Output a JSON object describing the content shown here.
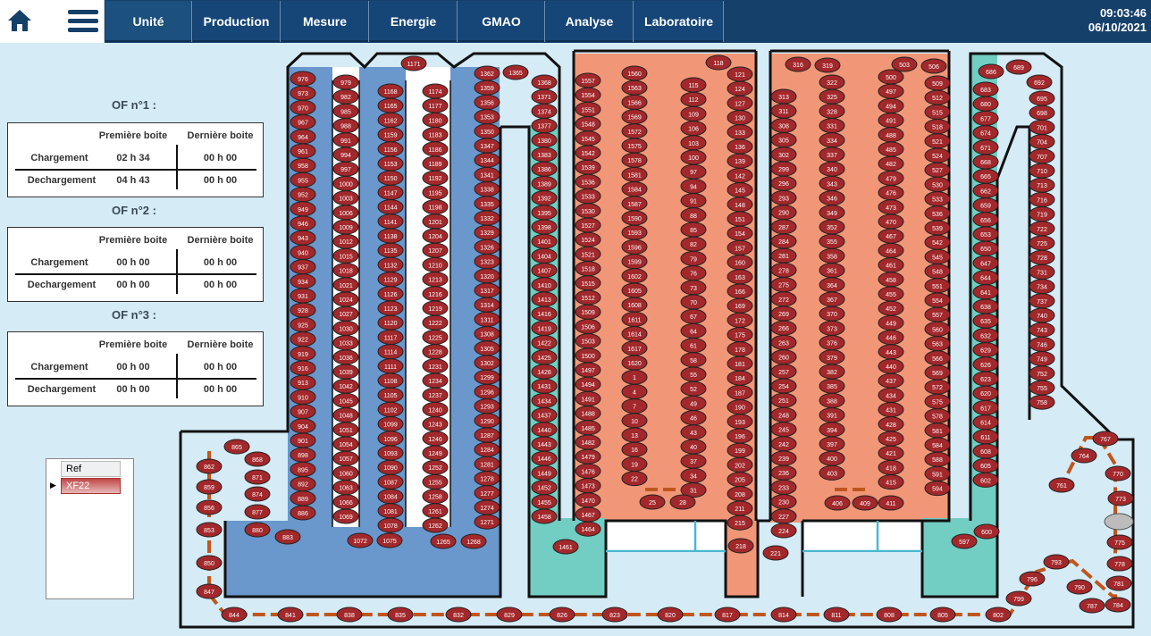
{
  "header": {
    "nav": [
      "Unité",
      "Production",
      "Mesure",
      "Energie",
      "GMAO",
      "Analyse",
      "Laboratoire"
    ],
    "time": "09:03:46",
    "date": "06/10/2021"
  },
  "of_panels": [
    {
      "title": "OF n°1 :",
      "col1": "Première boite",
      "col2": "Dernière boite",
      "row1": "Chargement",
      "row2": "Dechargement",
      "v11": "02 h 34",
      "v12": "00 h 00",
      "v21": "04 h 43",
      "v22": "00 h 00"
    },
    {
      "title": "OF n°2 :",
      "col1": "Première boite",
      "col2": "Dernière boite",
      "row1": "Chargement",
      "row2": "Dechargement",
      "v11": "00 h 00",
      "v12": "00 h 00",
      "v21": "00 h 00",
      "v22": "00 h 00"
    },
    {
      "title": "OF n°3 :",
      "col1": "Première boite",
      "col2": "Dernière boite",
      "row1": "Chargement",
      "row2": "Dechargement",
      "v11": "00 h 00",
      "v12": "00 h 00",
      "v21": "00 h 00",
      "v22": "00 h 00"
    }
  ],
  "ref_table": {
    "header": "Ref",
    "value": "XF22"
  },
  "plant": {
    "colors": {
      "box": "#a3282b",
      "zone_blue": "#6a97cc",
      "zone_salmon": "#f19778",
      "zone_teal": "#72cdc2",
      "path": "#c0561c"
    },
    "columns": [
      {
        "labels": [
          "976",
          "973",
          "970",
          "967",
          "964",
          "961",
          "958",
          "955",
          "952",
          "949",
          "946",
          "943",
          "940",
          "937",
          "934",
          "931",
          "928",
          "925",
          "922",
          "919",
          "916",
          "913",
          "910",
          "907",
          "904",
          "901",
          "898",
          "895",
          "892",
          "889",
          "886"
        ]
      },
      {
        "labels": [
          "979",
          "982",
          "985",
          "988",
          "991",
          "994",
          "997",
          "1000",
          "1003",
          "1006",
          "1009",
          "1012",
          "1015",
          "1018",
          "1021",
          "1024",
          "1027",
          "1030",
          "1033",
          "1036",
          "1039",
          "1042",
          "1045",
          "1048",
          "1051",
          "1054",
          "1057",
          "1060",
          "1063",
          "1066",
          "1069"
        ]
      },
      {
        "labels": [
          "1168",
          "1165",
          "1162",
          "1159",
          "1156",
          "1153",
          "1150",
          "1147",
          "1144",
          "1141",
          "1138",
          "1135",
          "1132",
          "1129",
          "1126",
          "1123",
          "1120",
          "1117",
          "1114",
          "1111",
          "1108",
          "1105",
          "1102",
          "1099",
          "1096",
          "1093",
          "1090",
          "1087",
          "1084",
          "1081",
          "1078"
        ]
      },
      {
        "labels": [
          "1174",
          "1177",
          "1180",
          "1183",
          "1186",
          "1189",
          "1192",
          "1195",
          "1198",
          "1201",
          "1204",
          "1207",
          "1210",
          "1213",
          "1216",
          "1219",
          "1222",
          "1225",
          "1228",
          "1231",
          "1234",
          "1237",
          "1240",
          "1243",
          "1246",
          "1249",
          "1252",
          "1255",
          "1258",
          "1261",
          "1262"
        ]
      },
      {
        "labels": [
          "1362",
          "1359",
          "1356",
          "1353",
          "1350",
          "1347",
          "1344",
          "1341",
          "1338",
          "1335",
          "1332",
          "1329",
          "1326",
          "1323",
          "1320",
          "1317",
          "1314",
          "1311",
          "1308",
          "1305",
          "1302",
          "1299",
          "1296",
          "1293",
          "1290",
          "1287",
          "1284",
          "1281",
          "1278",
          "1277",
          "1274",
          "1271"
        ]
      },
      {
        "labels": [
          "1368",
          "1371",
          "1374",
          "1377",
          "1380",
          "1383",
          "1386",
          "1389",
          "1392",
          "1395",
          "1398",
          "1401",
          "1404",
          "1407",
          "1410",
          "1413",
          "1416",
          "1419",
          "1422",
          "1425",
          "1428",
          "1431",
          "1434",
          "1437",
          "1440",
          "1443",
          "1446",
          "1449",
          "1452",
          "1455",
          "1458"
        ]
      },
      {
        "labels": [
          "1557",
          "1554",
          "1551",
          "1548",
          "1545",
          "1542",
          "1539",
          "1536",
          "1533",
          "1530",
          "1527",
          "1524",
          "1521",
          "1518",
          "1515",
          "1512",
          "1509",
          "1506",
          "1503",
          "1500",
          "1497",
          "1494",
          "1491",
          "1488",
          "1485",
          "1482",
          "1479",
          "1476",
          "1473",
          "1470",
          "1467",
          "1464"
        ]
      },
      {
        "labels": [
          "1560",
          "1563",
          "1566",
          "1569",
          "1572",
          "1575",
          "1578",
          "1581",
          "1584",
          "1587",
          "1590",
          "1593",
          "1596",
          "1599",
          "1602",
          "1605",
          "1608",
          "1611",
          "1614",
          "1617",
          "1620",
          "1",
          "4",
          "7",
          "10",
          "13",
          "16",
          "19",
          "22"
        ]
      },
      {
        "labels": [
          "115",
          "112",
          "109",
          "106",
          "103",
          "100",
          "97",
          "94",
          "91",
          "88",
          "85",
          "82",
          "79",
          "76",
          "73",
          "70",
          "67",
          "64",
          "61",
          "58",
          "55",
          "52",
          "49",
          "46",
          "43",
          "40",
          "37",
          "34",
          "31"
        ]
      },
      {
        "labels": [
          "121",
          "124",
          "127",
          "130",
          "133",
          "136",
          "139",
          "142",
          "145",
          "148",
          "151",
          "154",
          "157",
          "160",
          "163",
          "166",
          "169",
          "172",
          "175",
          "178",
          "181",
          "184",
          "187",
          "190",
          "193",
          "196",
          "199",
          "202",
          "205",
          "208",
          "211",
          "215"
        ]
      },
      {
        "labels": [
          "313",
          "311",
          "308",
          "305",
          "302",
          "299",
          "296",
          "293",
          "290",
          "287",
          "284",
          "281",
          "278",
          "275",
          "272",
          "269",
          "266",
          "263",
          "260",
          "257",
          "254",
          "251",
          "248",
          "245",
          "242",
          "239",
          "236",
          "233",
          "230",
          "227",
          "224"
        ]
      },
      {
        "labels": [
          "322",
          "325",
          "328",
          "331",
          "334",
          "337",
          "340",
          "343",
          "346",
          "349",
          "352",
          "355",
          "358",
          "361",
          "364",
          "367",
          "370",
          "373",
          "376",
          "379",
          "382",
          "385",
          "388",
          "391",
          "394",
          "397",
          "400",
          "403"
        ]
      },
      {
        "labels": [
          "500",
          "497",
          "494",
          "491",
          "488",
          "485",
          "482",
          "479",
          "476",
          "473",
          "470",
          "467",
          "464",
          "461",
          "458",
          "455",
          "452",
          "449",
          "446",
          "443",
          "440",
          "437",
          "434",
          "431",
          "428",
          "425",
          "421",
          "418",
          "415"
        ]
      },
      {
        "labels": [
          "509",
          "512",
          "515",
          "518",
          "521",
          "524",
          "527",
          "530",
          "533",
          "536",
          "539",
          "542",
          "545",
          "548",
          "551",
          "554",
          "557",
          "560",
          "563",
          "566",
          "569",
          "572",
          "575",
          "578",
          "581",
          "584",
          "588",
          "591",
          "594"
        ]
      },
      {
        "labels": [
          "683",
          "680",
          "677",
          "674",
          "671",
          "668",
          "665",
          "662",
          "659",
          "656",
          "653",
          "650",
          "647",
          "644",
          "641",
          "638",
          "635",
          "632",
          "629",
          "626",
          "623",
          "620",
          "617",
          "614",
          "611",
          "608",
          "605",
          "602"
        ]
      },
      {
        "labels": [
          "695",
          "698",
          "701",
          "704",
          "707",
          "710",
          "713",
          "716",
          "719",
          "722",
          "725",
          "728",
          "731",
          "734",
          "737",
          "740",
          "743",
          "746",
          "749",
          "752",
          "755",
          "758"
        ]
      }
    ],
    "extras": [
      "686",
      "689",
      "692",
      "118",
      "316",
      "319",
      "503",
      "506",
      "1171",
      "1365",
      "25",
      "28",
      "406",
      "409",
      "411",
      "1461",
      "1265",
      "1268",
      "218",
      "221",
      "597",
      "600",
      "1072",
      "1075",
      "883",
      "880",
      "877",
      "874",
      "871",
      "868",
      "865",
      "862",
      "859",
      "856",
      "853",
      "850",
      "847",
      "844",
      "841",
      "838",
      "835",
      "832",
      "829",
      "826",
      "823",
      "820",
      "817",
      "814",
      "811",
      "808",
      "805",
      "802",
      "799",
      "796",
      "793",
      "790",
      "787",
      "784",
      "781",
      "778",
      "775",
      "773",
      "770",
      "767",
      "764",
      "761"
    ],
    "gray_station_label": ""
  }
}
